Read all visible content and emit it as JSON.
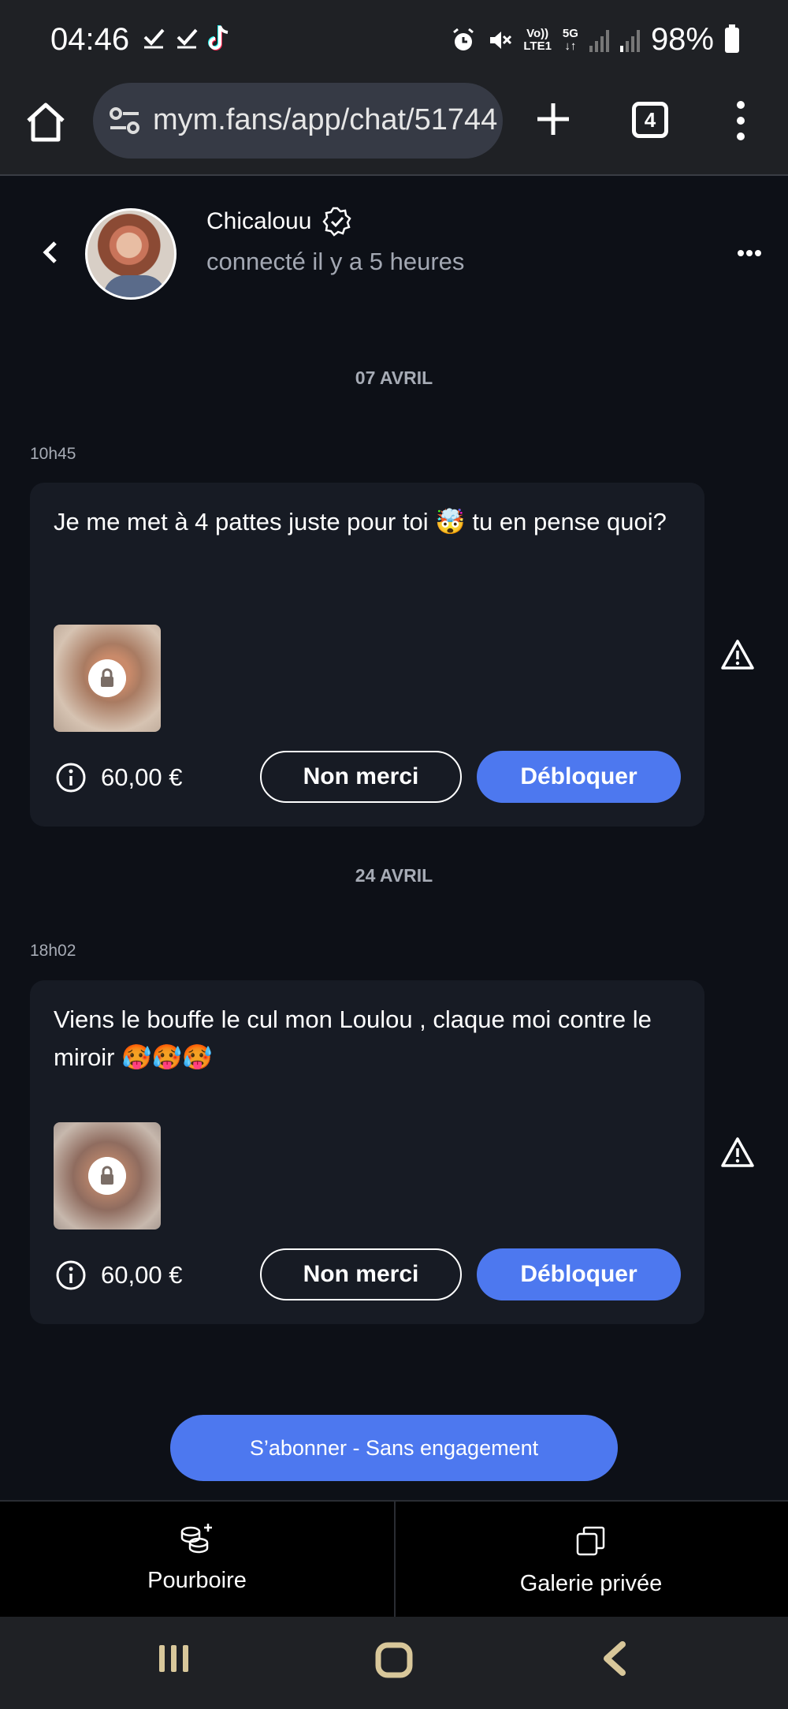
{
  "status_bar": {
    "time": "04:46",
    "volte_label": "Vo))",
    "lte_label": "LTE1",
    "network_label": "5G",
    "battery": "98%",
    "icons": [
      "check-icon",
      "check-icon",
      "tiktok-icon",
      "alarm-icon",
      "mute-icon",
      "signal-icon",
      "battery-icon"
    ]
  },
  "browser": {
    "url": "mym.fans/app/chat/51744",
    "tab_count": "4"
  },
  "chat_header": {
    "username": "Chicalouu",
    "status": "connecté il y a 5 heures"
  },
  "messages": [
    {
      "date": "07 AVRIL",
      "time": "10h45",
      "text": "Je me met à 4 pattes juste pour toi 🤯 tu en pense quoi?",
      "price": "60,00 €",
      "decline_label": "Non merci",
      "unlock_label": "Débloquer"
    },
    {
      "date": "24 AVRIL",
      "time": "18h02",
      "text": "Viens le bouffe le cul mon Loulou , claque moi contre le miroir 🥵🥵🥵",
      "price": "60,00 €",
      "decline_label": "Non merci",
      "unlock_label": "Débloquer"
    }
  ],
  "subscribe_label": "S’abonner - Sans engagement",
  "bottom_tabs": {
    "tip_label": "Pourboire",
    "gallery_label": "Galerie privée"
  },
  "colors": {
    "background": "#0d1017",
    "card": "#171b24",
    "accent": "#4d78ef",
    "muted_text": "#a6abb5"
  }
}
